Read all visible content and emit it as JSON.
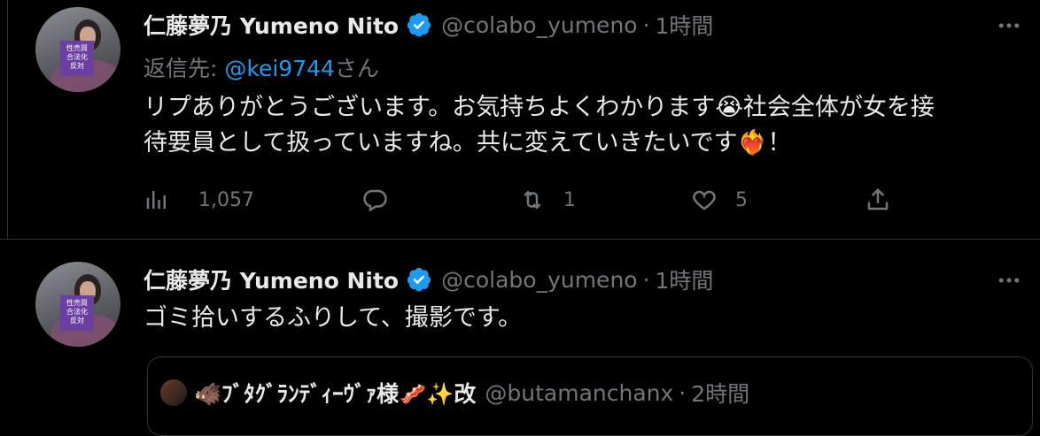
{
  "tweet1": {
    "author_name": "仁藤夢乃 Yumeno Nito",
    "handle": "@colabo_yumeno",
    "separator": "·",
    "time": "1時間",
    "reply_prefix": "返信先: ",
    "reply_mention": "@kei9744",
    "reply_suffix": "さん",
    "text_line1a": "リプありがとうございます。お気持ちよくわかります",
    "emoji1": "😭",
    "text_line1b": "社会全体が女を接",
    "text_line2a": "待要員として扱っていますね。共に変えていきたいです",
    "emoji2": "❤️‍🔥",
    "text_line2b": "！",
    "avatar_sign": "性売買\n合法化\n反対",
    "stats": {
      "views": "1,057",
      "retweets": "1",
      "likes": "5"
    }
  },
  "tweet2": {
    "author_name": "仁藤夢乃 Yumeno Nito",
    "handle": "@colabo_yumeno",
    "separator": "·",
    "time": "1時間",
    "text": "ゴミ拾いするふりして、撮影です。",
    "avatar_sign": "性売買\n合法化\n反対"
  },
  "quote": {
    "author_name": "🐗ﾌﾞﾀｸﾞﾗﾝﾃﾞｨｰｳﾞｧ様🥓✨改",
    "handle": "@butamanchanx",
    "separator": "·",
    "time": "2時間"
  },
  "colors": {
    "background": "#000000",
    "text": "#e7e9ea",
    "muted": "#71767b",
    "accent": "#1d9bf0",
    "border": "#2f3336"
  },
  "icons": [
    "more-icon",
    "verified-icon",
    "views-icon",
    "reply-icon",
    "retweet-icon",
    "like-icon",
    "share-icon"
  ]
}
